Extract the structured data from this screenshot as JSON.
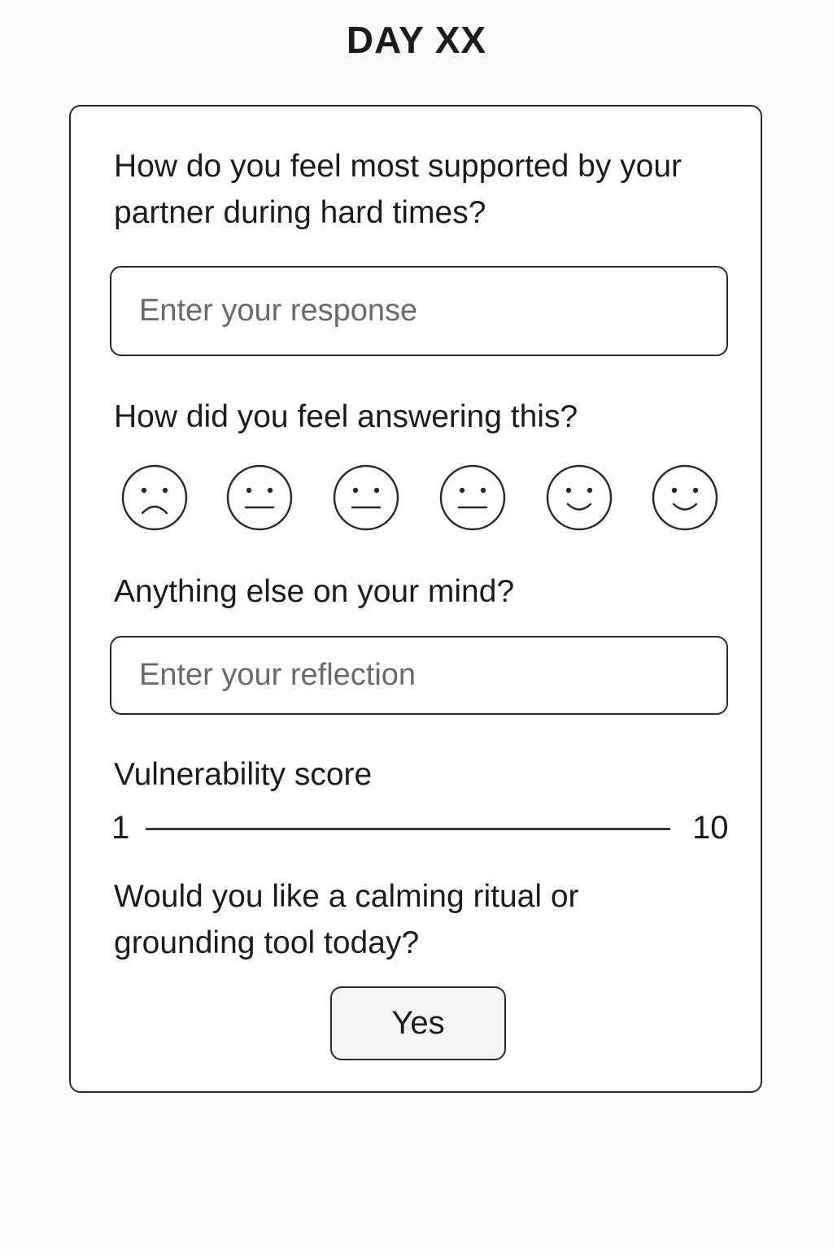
{
  "header": {
    "title": "DAY XX"
  },
  "questions": {
    "support": "How do you feel most supported by your partner during hard times?",
    "feeling": "How did you feel answering this?",
    "mind": "Anything else on your mind?",
    "vulnerability": "Vulnerability score",
    "ritual": "Would you like a calming ritual or grounding tool today?"
  },
  "inputs": {
    "response": {
      "value": "",
      "placeholder": "Enter your response"
    },
    "reflection": {
      "value": "",
      "placeholder": "Enter your reflection"
    }
  },
  "moods": [
    {
      "icon": "sad-face-icon"
    },
    {
      "icon": "neutral-face-icon"
    },
    {
      "icon": "neutral-face-icon"
    },
    {
      "icon": "neutral-face-icon"
    },
    {
      "icon": "smiling-face-icon"
    },
    {
      "icon": "smiling-face-icon"
    }
  ],
  "slider": {
    "min_label": "1",
    "max_label": "10"
  },
  "ritual_button": {
    "label": "Yes"
  },
  "colors": {
    "background": "#fafafa",
    "card": "#ffffff",
    "border": "#2a2a2a",
    "text": "#1c1c1c",
    "placeholder": "#6a6a6a"
  }
}
